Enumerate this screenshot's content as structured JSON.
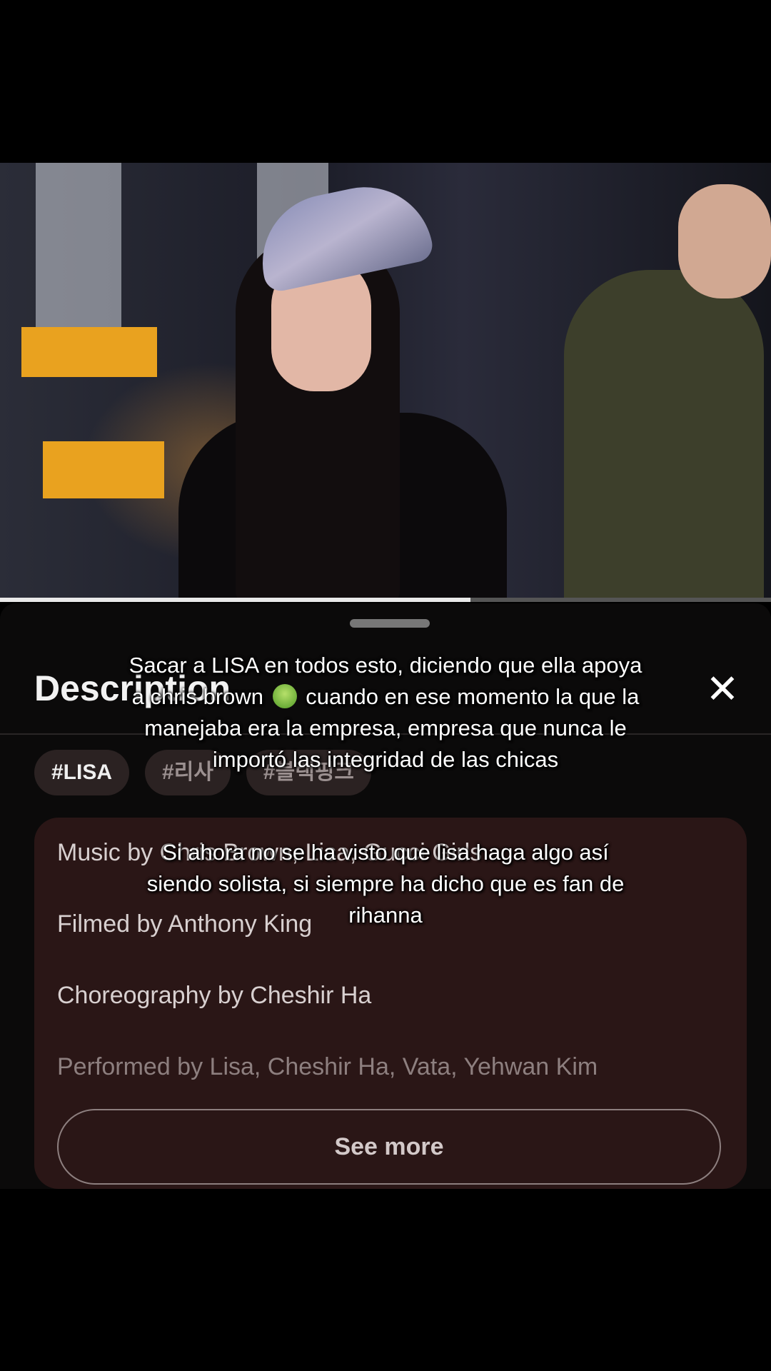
{
  "video": {
    "progress_fraction": 0.61,
    "buffered_fraction": 0.13
  },
  "sheet": {
    "title": "Description",
    "close_icon": "close-icon",
    "tags": [
      "#LISA",
      "#리사",
      "#블랙핑크"
    ],
    "credits": [
      "Music by Chris Brown, Lisa, Gucci Girls",
      "Filmed by Anthony King",
      "Choreography by Cheshir Ha",
      "Performed by Lisa, Cheshir Ha, Vata, Yehwan Kim"
    ],
    "see_more_label": "See more"
  },
  "overlay": {
    "caption_1_part_a": "Sacar a LISA en todos esto, diciendo que ella apoya a chris brown",
    "caption_1_emoji": "nauseated-face-icon",
    "caption_1_part_b": "cuando en ese momento la que la manejaba era la empresa, empresa que nunca le importó las integridad de las chicas",
    "caption_2": "Si ahora no se ha visto que lisa haga algo así siendo solista, si siempre ha dicho que es fan de rihanna"
  }
}
